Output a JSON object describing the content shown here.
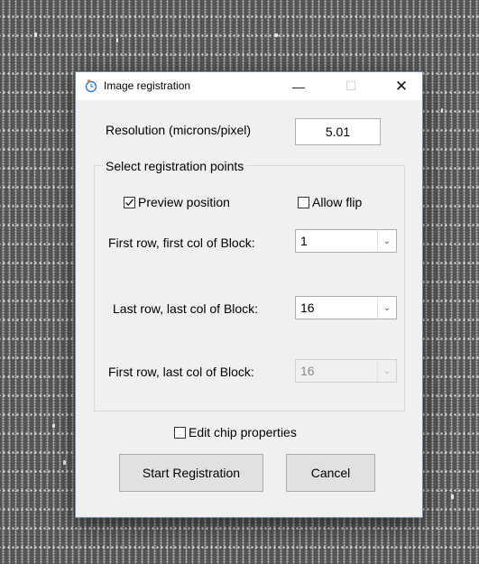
{
  "window": {
    "title": "Image registration",
    "minimize_glyph": "—",
    "maximize_glyph": "☐",
    "close_glyph": "✕"
  },
  "resolution": {
    "label": "Resolution (microns/pixel)",
    "value": "5.01"
  },
  "group": {
    "title": "Select registration points",
    "preview_position": {
      "label": "Preview position",
      "checked": true
    },
    "allow_flip": {
      "label": "Allow flip",
      "checked": false
    },
    "fields": [
      {
        "label": "First row, first col of Block:",
        "value": "1",
        "enabled": true
      },
      {
        "label": "Last row, last col of Block:",
        "value": "16",
        "enabled": true
      },
      {
        "label": "First row, last col of Block:",
        "value": "16",
        "enabled": false
      }
    ]
  },
  "edit_chip": {
    "label": "Edit chip properties",
    "checked": false
  },
  "buttons": {
    "start": "Start Registration",
    "cancel": "Cancel"
  },
  "icons": {
    "app": "registration-icon",
    "checkmark": "✓",
    "dropdown": "chevron-down-icon"
  },
  "colors": {
    "window_bg": "#f0f0f0",
    "titlebar_bg": "#ffffff",
    "background": "#4f4f4f"
  }
}
